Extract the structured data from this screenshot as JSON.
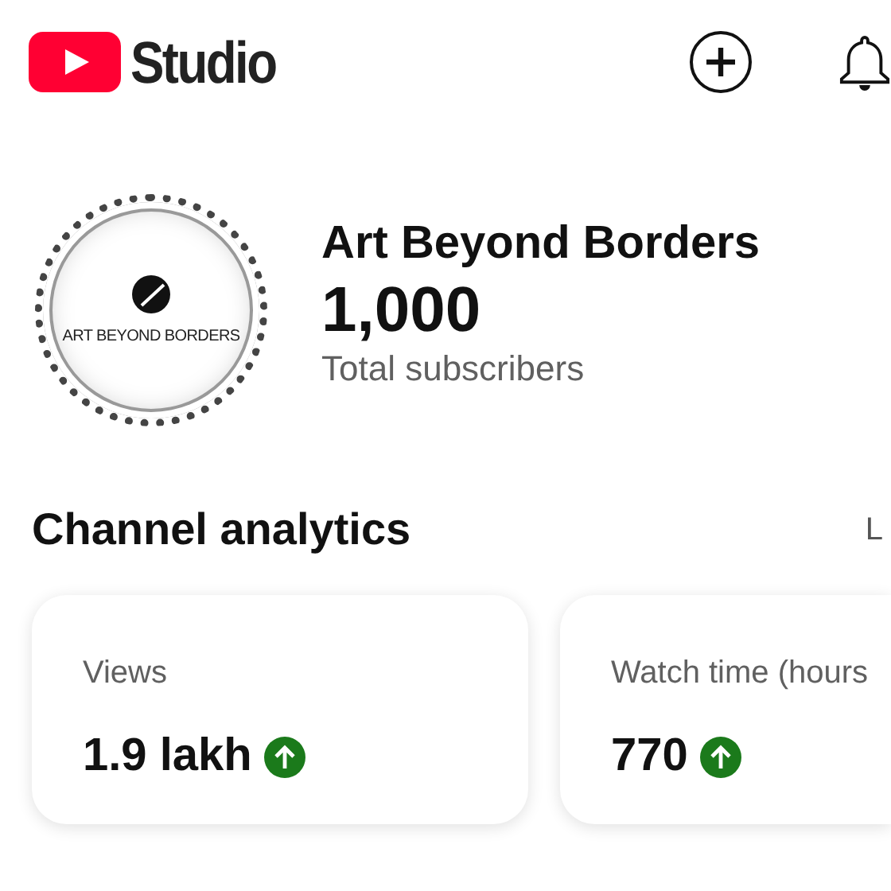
{
  "header": {
    "logo_text": "Studio"
  },
  "channel": {
    "avatar_text": "ART BEYOND BORDERS",
    "name": "Art Beyond Borders",
    "subscribers": "1,000",
    "subscribers_label": "Total subscribers"
  },
  "analytics": {
    "title": "Channel analytics",
    "link": "L",
    "cards": [
      {
        "label": "Views",
        "value": "1.9 lakh",
        "increasing": true
      },
      {
        "label": "Watch time (hours",
        "value": "770",
        "increasing": true
      }
    ]
  }
}
